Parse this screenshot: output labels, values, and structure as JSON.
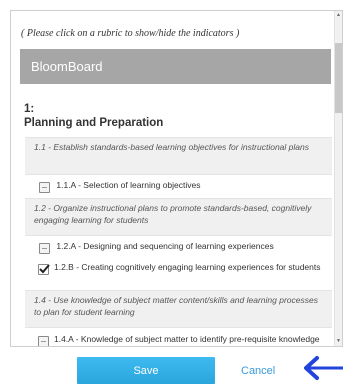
{
  "instruction": "( Please click on a rubric to show/hide the indicators )",
  "brand": "BloomBoard",
  "domain_number": "1:",
  "domain_title": "Planning and Preparation",
  "rows": [
    {
      "kind": "component",
      "text": "1.1 - Establish standards-based learning objectives for instructional plans"
    },
    {
      "kind": "indicator",
      "text": "1.1.A - Selection of learning objectives",
      "checked": false
    },
    {
      "kind": "component",
      "text": "1.2 - Organize instructional plans to promote standards-based, cognitively engaging learning for students"
    },
    {
      "kind": "indicator",
      "text": "1.2.A - Designing and sequencing of learning experiences",
      "checked": false
    },
    {
      "kind": "indicator",
      "text": "1.2.B - Creating cognitively engaging learning experiences for students",
      "checked": true
    },
    {
      "kind": "component",
      "text": "1.4 - Use knowledge of subject matter content/skills and learning processes to plan for student learning"
    },
    {
      "kind": "indicator",
      "text": "1.4.A - Knowledge of subject matter to identify pre-requisite knowledge",
      "checked": false
    }
  ],
  "footer": {
    "save_label": "Save",
    "cancel_label": "Cancel"
  },
  "colors": {
    "save_button": "#33b0e6",
    "cancel_link": "#3a9ad9",
    "brand_bar": "#a6a6a6",
    "pointer_arrow": "#2244dd"
  }
}
